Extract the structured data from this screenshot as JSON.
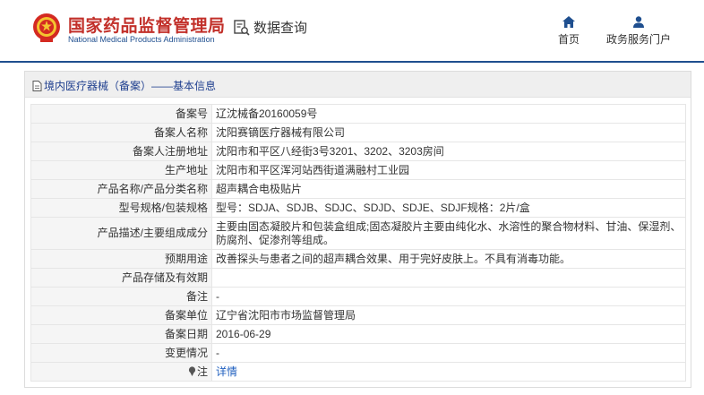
{
  "header": {
    "site_title": "国家药品监督管理局",
    "site_subtitle": "National Medical Products Administration",
    "db_query_label": "数据查询",
    "nav_home": "首页",
    "nav_portal": "政务服务门户"
  },
  "panel": {
    "title": "境内医疗器械（备案）——基本信息"
  },
  "rows": [
    {
      "label": "备案号",
      "value": "辽沈械备20160059号"
    },
    {
      "label": "备案人名称",
      "value": "沈阳赛镝医疗器械有限公司"
    },
    {
      "label": "备案人注册地址",
      "value": "沈阳市和平区八经街3号3201、3202、3203房间"
    },
    {
      "label": "生产地址",
      "value": "沈阳市和平区浑河站西街道满融村工业园"
    },
    {
      "label": "产品名称/产品分类名称",
      "value": "超声耦合电极贴片"
    },
    {
      "label": "型号规格/包装规格",
      "value": "型号：SDJA、SDJB、SDJC、SDJD、SDJE、SDJF规格：2片/盒"
    },
    {
      "label": "产品描述/主要组成成分",
      "value": "主要由固态凝胶片和包装盒组成;固态凝胶片主要由纯化水、水溶性的聚合物材料、甘油、保湿剂、防腐剂、促渗剂等组成。"
    },
    {
      "label": "预期用途",
      "value": "改善探头与患者之间的超声耦合效果、用于完好皮肤上。不具有消毒功能。"
    },
    {
      "label": "产品存储及有效期",
      "value": ""
    },
    {
      "label": "备注",
      "value": "-"
    },
    {
      "label": "备案单位",
      "value": "辽宁省沈阳市市场监督管理局"
    },
    {
      "label": "备案日期",
      "value": "2016-06-29"
    },
    {
      "label": "变更情况",
      "value": "-"
    },
    {
      "label": "注",
      "value": "详情"
    }
  ],
  "colors": {
    "brand_red": "#c2302a",
    "brand_blue": "#1f4f8f",
    "link_blue": "#1f5fbf"
  },
  "icons": {
    "logo": "national-emblem-icon",
    "db_query": "search-document-icon",
    "home": "home-icon",
    "portal": "user-icon",
    "panel_title": "document-icon",
    "note": "pin-icon"
  }
}
